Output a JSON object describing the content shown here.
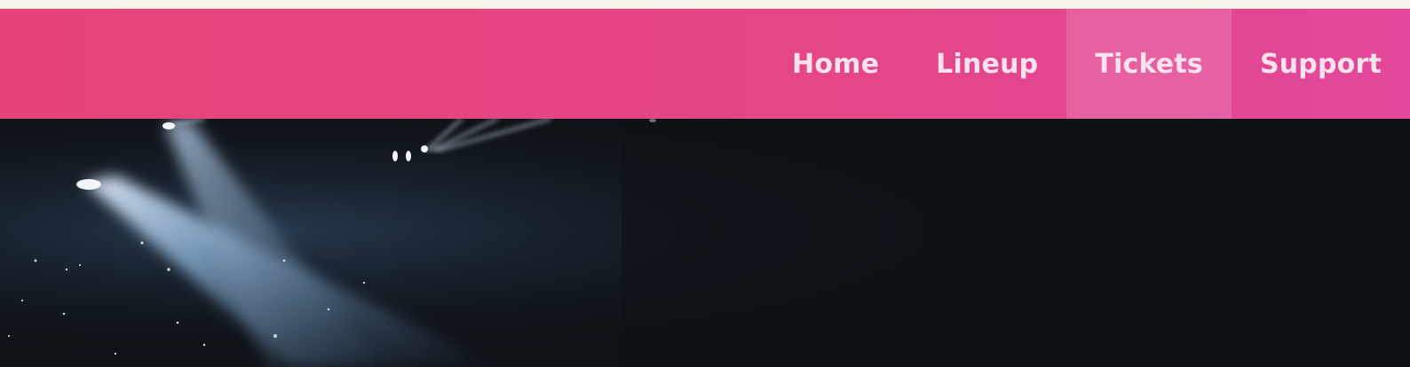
{
  "nav": {
    "items": [
      {
        "label": "Home",
        "active": false
      },
      {
        "label": "Lineup",
        "active": false
      },
      {
        "label": "Tickets",
        "active": true
      },
      {
        "label": "Support",
        "active": false
      }
    ]
  },
  "colors": {
    "navbar_start": "#e7437a",
    "navbar_end": "#e2479b",
    "nav_text": "#fbe3ee",
    "hero_background": "#0e1217",
    "spotlight": "#8fb6dc"
  },
  "hero": {
    "image": "concert-spotlights-image"
  }
}
